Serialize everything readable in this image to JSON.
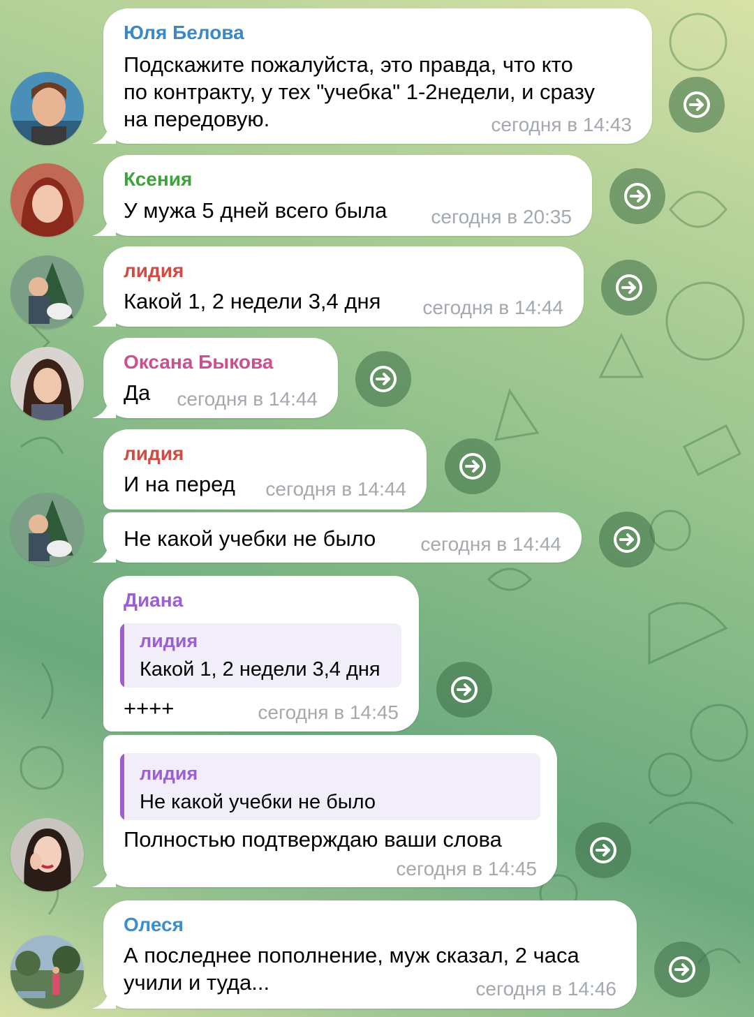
{
  "colors": {
    "name_blue": "#3b88c8",
    "name_green": "#3da43b",
    "name_red": "#d24a44",
    "name_pink": "#cc4f8f",
    "name_purple": "#9b5fd2",
    "name_cyan": "#3b8fcf",
    "time_gray": "#a3a9ae"
  },
  "messages": [
    {
      "sender": "Юля Белова",
      "lines": [
        "Подскажите пожалуйста, это правда, что кто",
        "по контракту, у тех \"учебка\" 1-2недели, и сразу",
        "на передовую."
      ],
      "time": "сегодня в 14:43"
    },
    {
      "sender": "Ксения",
      "lines": [
        "У мужа 5 дней всего была"
      ],
      "time": "сегодня в 20:35"
    },
    {
      "sender": "лидия",
      "lines": [
        "Какой 1, 2 недели 3,4 дня"
      ],
      "time": "сегодня в 14:44"
    },
    {
      "sender": "Оксана Быкова",
      "lines": [
        "Да"
      ],
      "time": "сегодня в 14:44"
    },
    {
      "sender": "лидия",
      "lines": [
        "И на перед"
      ],
      "time": "сегодня в 14:44"
    },
    {
      "lines": [
        "Не какой учебки не было"
      ],
      "time": "сегодня в 14:44"
    },
    {
      "sender": "Диана",
      "reply": {
        "name": "лидия",
        "text": "Какой 1, 2 недели 3,4 дня"
      },
      "lines": [
        "++++"
      ],
      "time": "сегодня в 14:45"
    },
    {
      "reply": {
        "name": "лидия",
        "text": "Не какой учебки не было"
      },
      "lines": [
        "Полностью подтверждаю ваши слова"
      ],
      "time": "сегодня в 14:45"
    },
    {
      "sender": "Олеся",
      "lines": [
        "А последнее пополнение, муж сказал, 2 часа",
        "учили и туда..."
      ],
      "time": "сегодня в 14:46"
    }
  ]
}
